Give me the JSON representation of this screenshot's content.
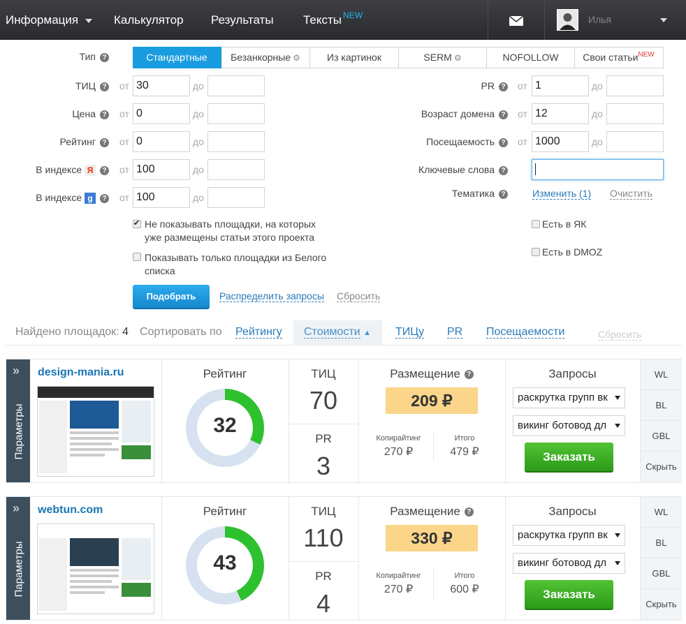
{
  "nav": {
    "info": "Информация",
    "calc": "Калькулятор",
    "results": "Результаты",
    "texts": "Тексты",
    "texts_badge": "NEW",
    "user": "Илья"
  },
  "filters": {
    "type_label": "Тип",
    "tabs": [
      "Стандартные",
      "Безанкорные",
      "Из картинок",
      "SERM",
      "NOFOLLOW",
      "Свои статьи"
    ],
    "tabs_badge": "NEW",
    "from": "от",
    "to": "до",
    "tic_label": "ТИЦ",
    "tic_from": "30",
    "price_label": "Цена",
    "price_from": "0",
    "rating_label": "Рейтинг",
    "rating_from": "0",
    "index_label": "В индексе",
    "index_y_from": "100",
    "index_g_from": "100",
    "pr_label": "PR",
    "pr_from": "1",
    "age_label": "Возраст домена",
    "age_from": "12",
    "visits_label": "Посещаемость",
    "visits_from": "1000",
    "keywords_label": "Ключевые слова",
    "topic_label": "Тематика",
    "topic_change": "Изменить (1)",
    "topic_clear": "Очистить",
    "cb1": "Не показывать площадки, на которых уже размещены статьи этого проекта",
    "cb2": "Показывать только площадки из Белого списка",
    "cb_yak": "Есть в ЯК",
    "cb_dmoz": "Есть в DMOZ",
    "submit": "Подобрать",
    "distribute": "Распределить запросы",
    "reset": "Сбросить"
  },
  "results_bar": {
    "found_label": "Найдено площадок:",
    "found_count": "4",
    "sort_label": "Сортировать по",
    "sort_rating": "Рейтингу",
    "sort_cost": "Стоимости",
    "sort_tic": "ТИЦу",
    "sort_pr": "PR",
    "sort_visits": "Посещаемости",
    "reset": "Сбросить"
  },
  "cards": [
    {
      "side": "Параметры",
      "site": "design-mania.ru",
      "rating_label": "Рейтинг",
      "rating": 32,
      "tic_label": "ТИЦ",
      "tic": "70",
      "pr_label": "PR",
      "pr": "3",
      "placement_label": "Размещение",
      "placement": "209 ₽",
      "copy_label": "Копирайтинг",
      "copy": "270 ₽",
      "total_label": "Итого",
      "total": "479 ₽",
      "queries_label": "Запросы",
      "q1": "раскрутка групп вк",
      "q2": "викинг ботовод дл",
      "order": "Заказать",
      "wl": "WL",
      "bl": "BL",
      "gbl": "GBL",
      "hide": "Скрыть"
    },
    {
      "side": "Параметры",
      "site": "webtun.com",
      "rating_label": "Рейтинг",
      "rating": 43,
      "tic_label": "ТИЦ",
      "tic": "110",
      "pr_label": "PR",
      "pr": "4",
      "placement_label": "Размещение",
      "placement": "330 ₽",
      "copy_label": "Копирайтинг",
      "copy": "270 ₽",
      "total_label": "Итого",
      "total": "600 ₽",
      "queries_label": "Запросы",
      "q1": "раскрутка групп вк",
      "q2": "викинг ботовод дл",
      "order": "Заказать",
      "wl": "WL",
      "bl": "BL",
      "gbl": "GBL",
      "hide": "Скрыть"
    }
  ]
}
